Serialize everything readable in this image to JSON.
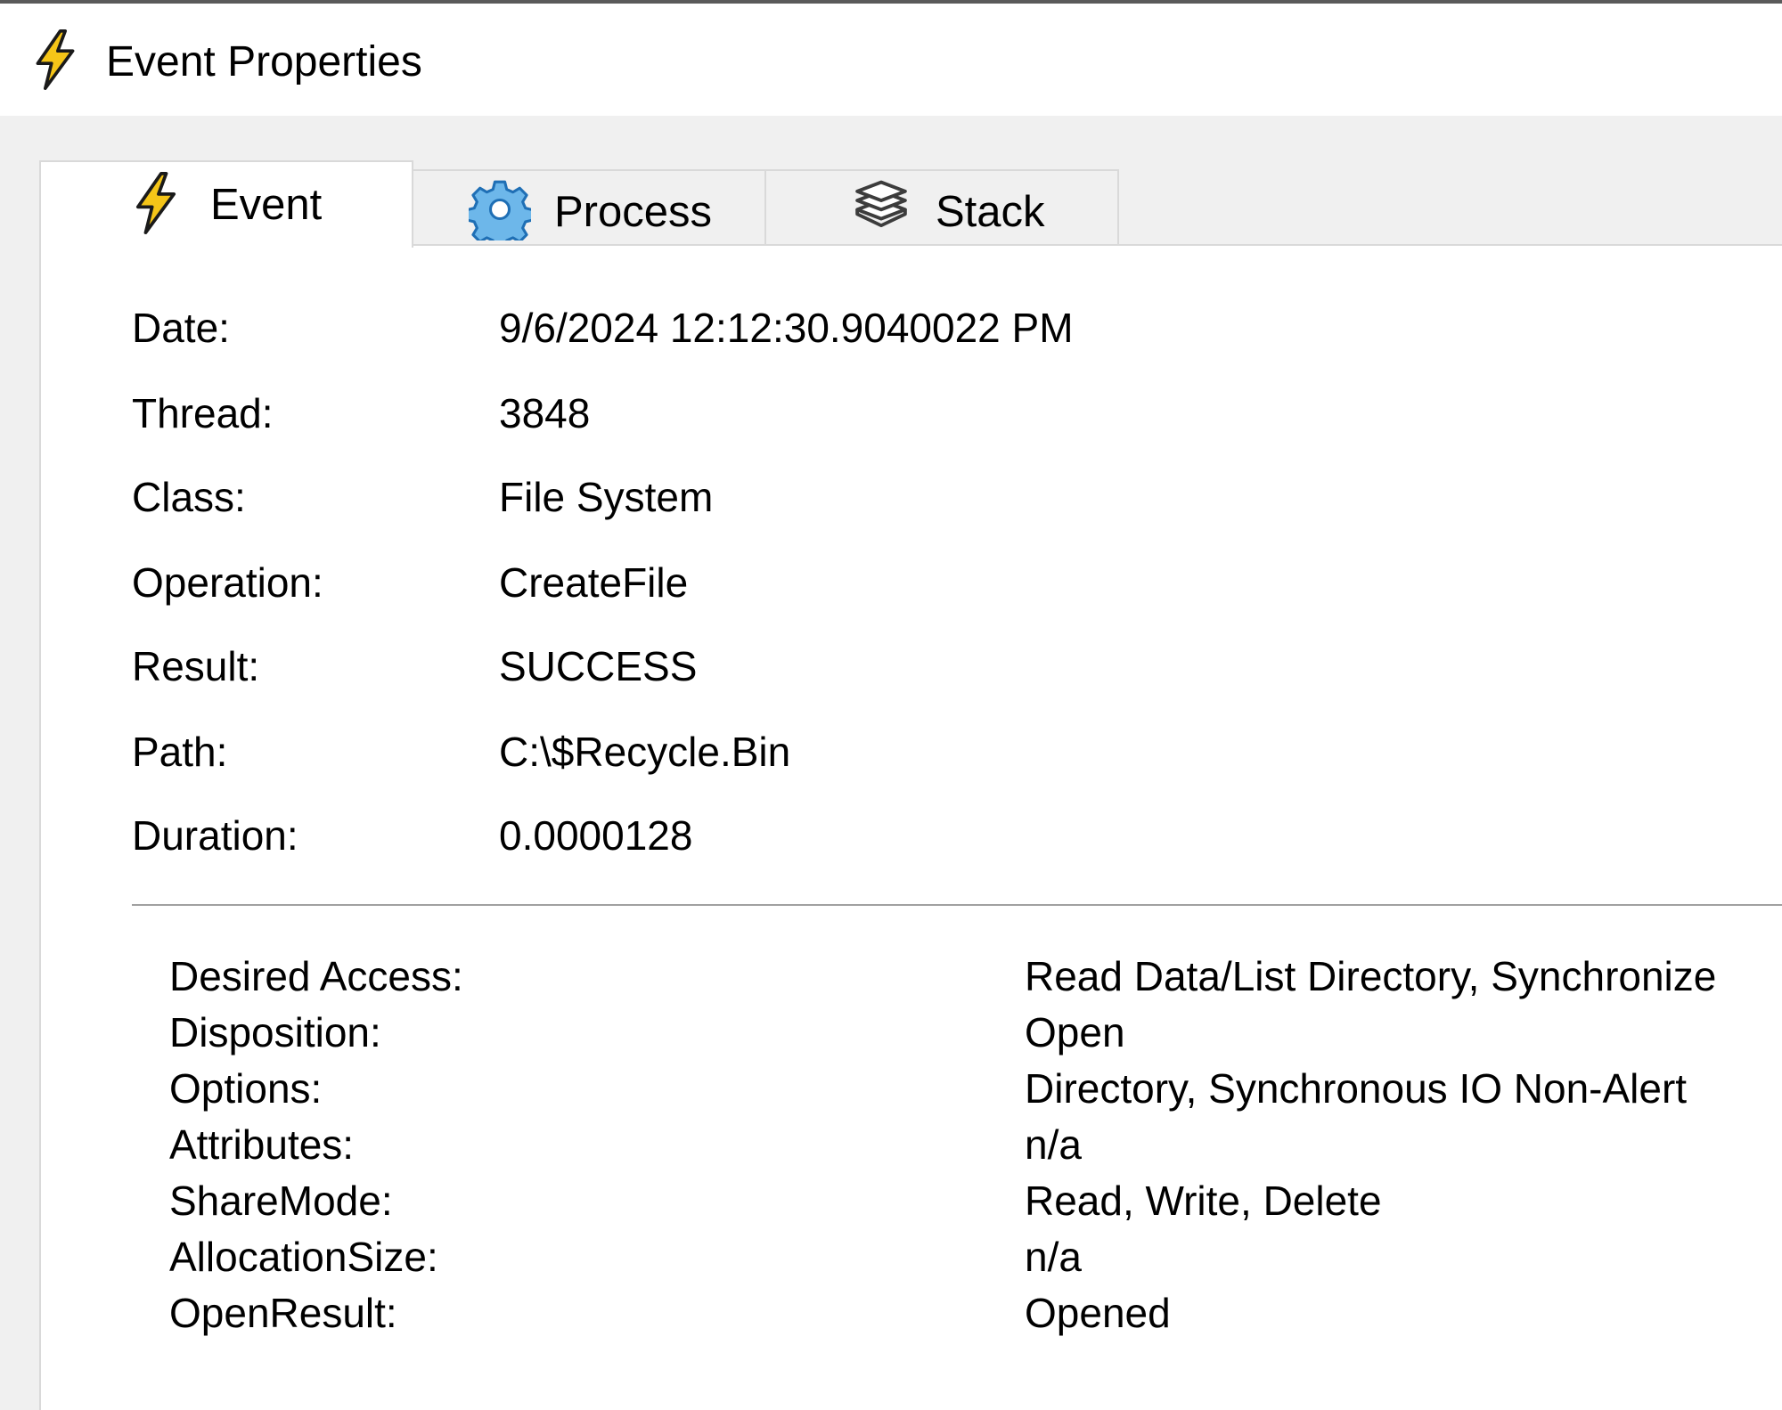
{
  "window": {
    "title": "Event Properties",
    "title_icon": "lightning-icon"
  },
  "tabs": [
    {
      "label": "Event",
      "icon": "lightning-icon",
      "active": true
    },
    {
      "label": "Process",
      "icon": "gear-icon",
      "active": false
    },
    {
      "label": "Stack",
      "icon": "layers-icon",
      "active": false
    }
  ],
  "properties": [
    {
      "label": "Date:",
      "value": "9/6/2024 12:12:30.9040022 PM"
    },
    {
      "label": "Thread:",
      "value": "3848"
    },
    {
      "label": "Class:",
      "value": "File System"
    },
    {
      "label": "Operation:",
      "value": "CreateFile"
    },
    {
      "label": "Result:",
      "value": "SUCCESS"
    },
    {
      "label": "Path:",
      "value": "C:\\$Recycle.Bin"
    },
    {
      "label": "Duration:",
      "value": "0.0000128"
    }
  ],
  "details": [
    {
      "label": "Desired Access:",
      "value": "Read Data/List Directory, Synchronize"
    },
    {
      "label": "Disposition:",
      "value": "Open"
    },
    {
      "label": "Options:",
      "value": "Directory, Synchronous IO Non-Alert"
    },
    {
      "label": "Attributes:",
      "value": "n/a"
    },
    {
      "label": "ShareMode:",
      "value": "Read, Write, Delete"
    },
    {
      "label": "AllocationSize:",
      "value": "n/a"
    },
    {
      "label": "OpenResult:",
      "value": "Opened"
    }
  ],
  "colors": {
    "lightning": "#f5c518",
    "gear": "#3a8fd6",
    "layers": "#3c3c3c"
  }
}
